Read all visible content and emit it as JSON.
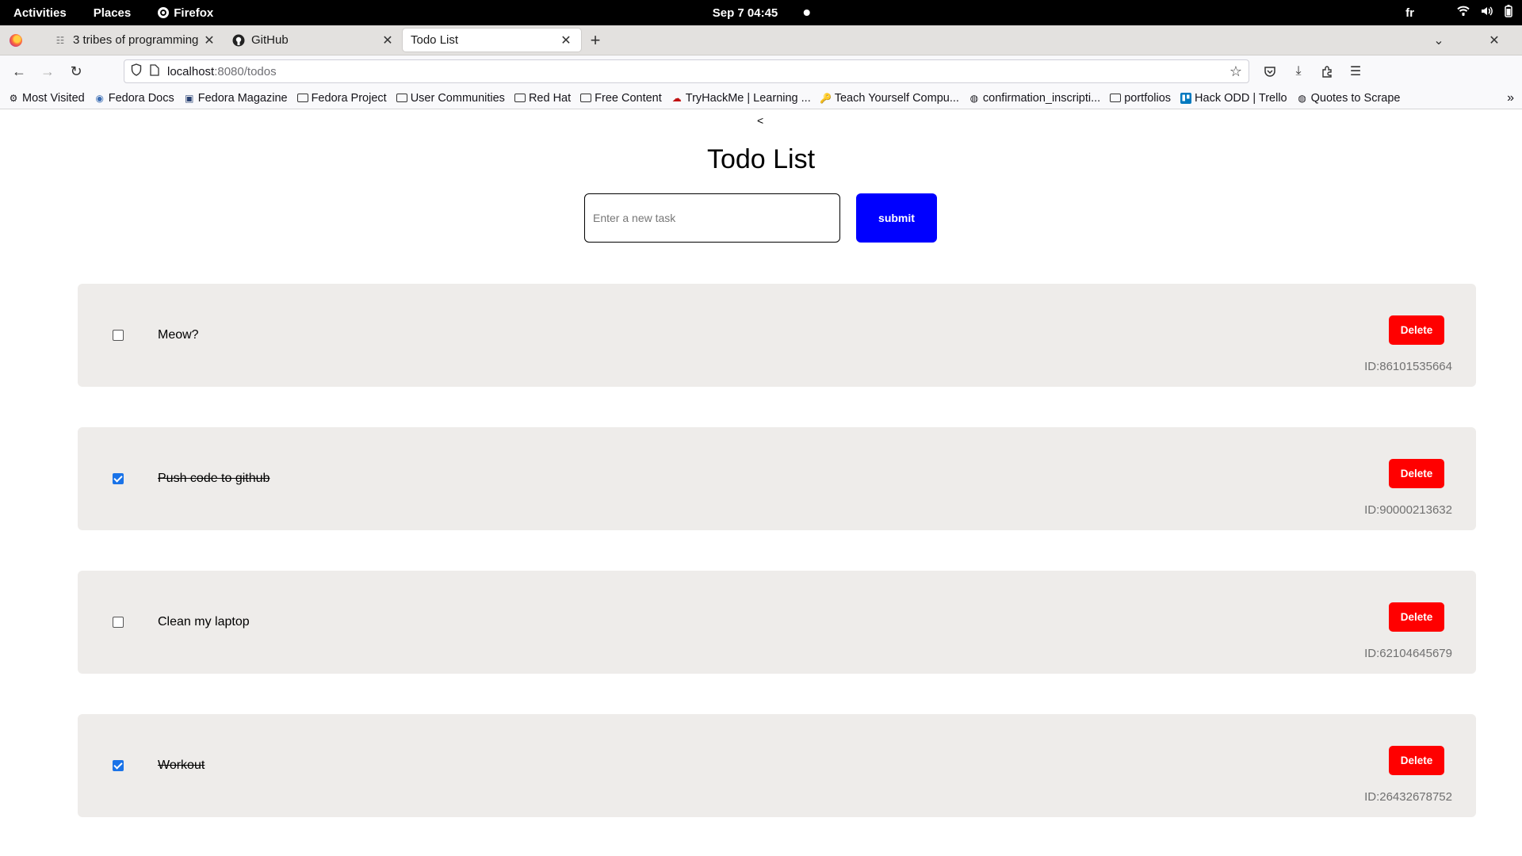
{
  "system_bar": {
    "activities": "Activities",
    "places": "Places",
    "app_name": "Firefox",
    "datetime": "Sep 7  04:45",
    "language": "fr"
  },
  "tabs": [
    {
      "label": "3 tribes of programming",
      "icon": "article-icon",
      "active": false
    },
    {
      "label": "GitHub",
      "icon": "github-icon",
      "active": false
    },
    {
      "label": "Todo List",
      "icon": "",
      "active": true
    }
  ],
  "url": {
    "host": "localhost",
    "path": ":8080/todos"
  },
  "bookmarks": [
    {
      "label": "Most Visited",
      "icon": "gear-icon"
    },
    {
      "label": "Fedora Docs",
      "icon": "fedora-icon"
    },
    {
      "label": "Fedora Magazine",
      "icon": "magazine-icon"
    },
    {
      "label": "Fedora Project",
      "icon": "folder-icon"
    },
    {
      "label": "User Communities",
      "icon": "folder-icon"
    },
    {
      "label": "Red Hat",
      "icon": "folder-icon"
    },
    {
      "label": "Free Content",
      "icon": "folder-icon"
    },
    {
      "label": "TryHackMe | Learning ...",
      "icon": "tryhackme-icon"
    },
    {
      "label": "Teach Yourself Compu...",
      "icon": "key-icon"
    },
    {
      "label": "confirmation_inscripti...",
      "icon": "globe-icon"
    },
    {
      "label": "portfolios",
      "icon": "folder-icon"
    },
    {
      "label": "Hack ODD | Trello",
      "icon": "trello-icon"
    },
    {
      "label": "Quotes to Scrape",
      "icon": "globe-icon"
    }
  ],
  "page": {
    "back_link": "<",
    "title": "Todo List",
    "input_placeholder": "Enter a new task",
    "submit_label": "submit"
  },
  "todos": [
    {
      "text": "Meow?",
      "done": false,
      "id_label": "ID:86101535664",
      "delete_label": "Delete"
    },
    {
      "text": "Push code to github",
      "done": true,
      "id_label": "ID:90000213632",
      "delete_label": "Delete"
    },
    {
      "text": "Clean my laptop",
      "done": false,
      "id_label": "ID:62104645679",
      "delete_label": "Delete"
    },
    {
      "text": "Workout",
      "done": true,
      "id_label": "ID:26432678752",
      "delete_label": "Delete"
    }
  ],
  "colors": {
    "submit": "#0000ff",
    "delete": "#ff0000",
    "card_bg": "#eeecea",
    "checkbox_checked": "#1a73e8"
  }
}
